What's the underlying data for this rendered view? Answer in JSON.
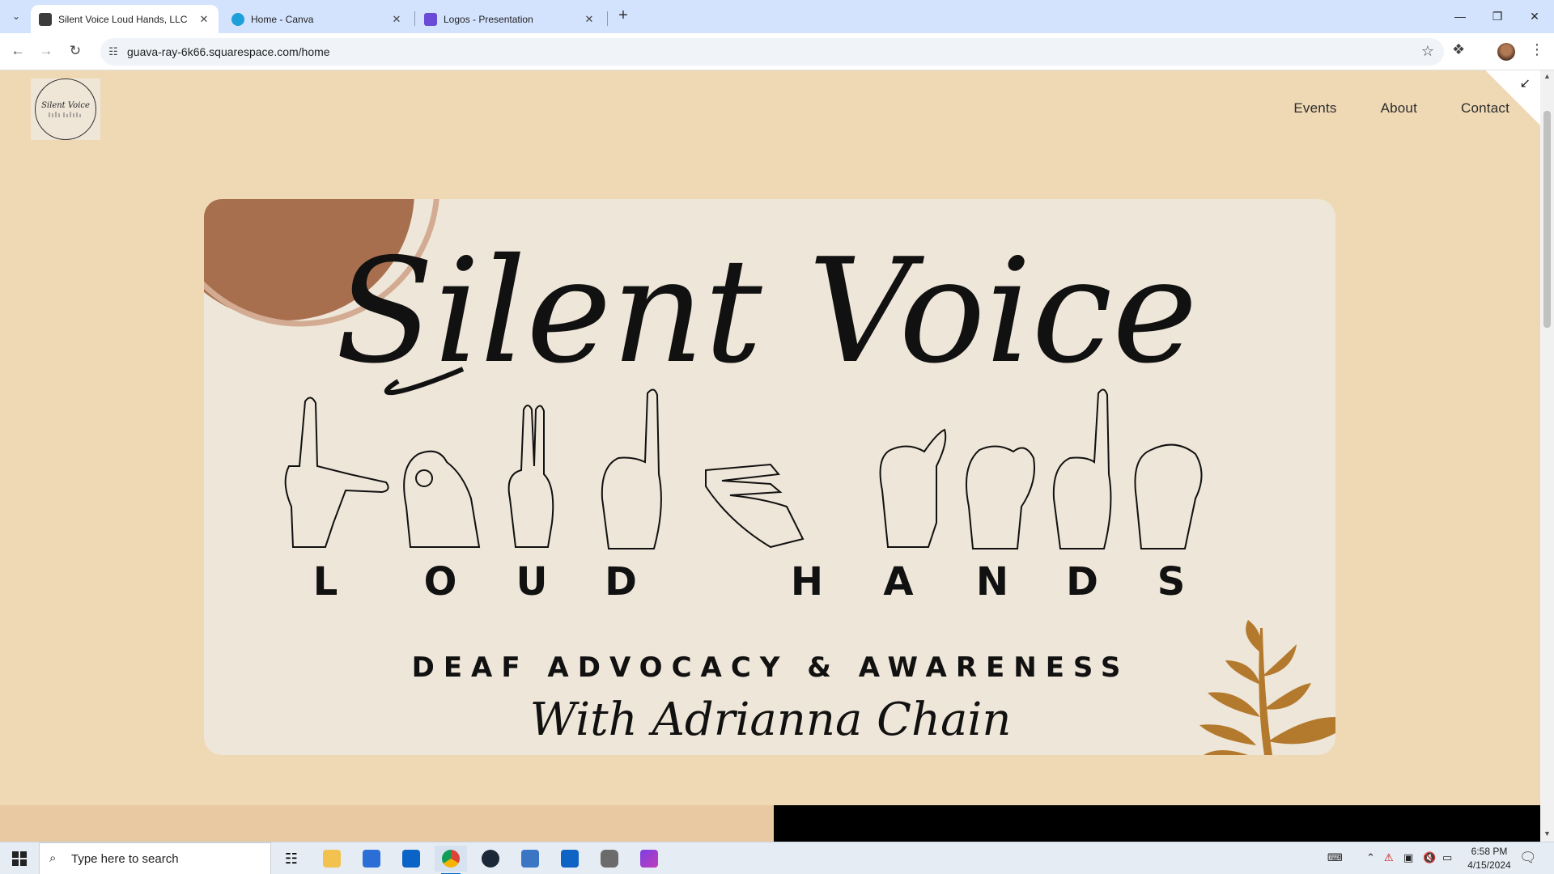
{
  "browser": {
    "tabs": [
      {
        "label": "Silent Voice Loud Hands, LLC",
        "active": true,
        "favicon_color": "#3c3c3c"
      },
      {
        "label": "Home - Canva",
        "active": false,
        "favicon_color": "#1d9fd9"
      },
      {
        "label": "Logos - Presentation",
        "active": false,
        "favicon_color": "#6a4bd6"
      }
    ],
    "new_tab_symbol": "+",
    "close_symbol": "✕",
    "url": "guava-ray-6k66.squarespace.com/home",
    "window_controls": {
      "minimize": "—",
      "restore": "❐",
      "close": "✕"
    }
  },
  "site": {
    "logo_text": "Silent Voice",
    "nav": [
      "Events",
      "About",
      "Contact"
    ]
  },
  "hero": {
    "script_title": "Silent Voice",
    "letters": [
      "L",
      "O",
      "U",
      "D",
      "H",
      "A",
      "N",
      "D",
      "S"
    ],
    "tagline": "DEAF ADVOCACY & AWARENESS",
    "signature": "With Adrianna Chain",
    "colors": {
      "card": "#eee6d8",
      "circle": "#a86f4f",
      "leaf": "#b37a2d",
      "ink": "#111111"
    }
  },
  "taskbar": {
    "search_placeholder": "Type here to search",
    "time": "6:58 PM",
    "date": "4/15/2024",
    "pinned": [
      "task-view",
      "file-explorer",
      "microsoft-store",
      "mail",
      "chrome",
      "steam",
      "calculator",
      "outlook",
      "clock-app",
      "clipchamp"
    ]
  }
}
